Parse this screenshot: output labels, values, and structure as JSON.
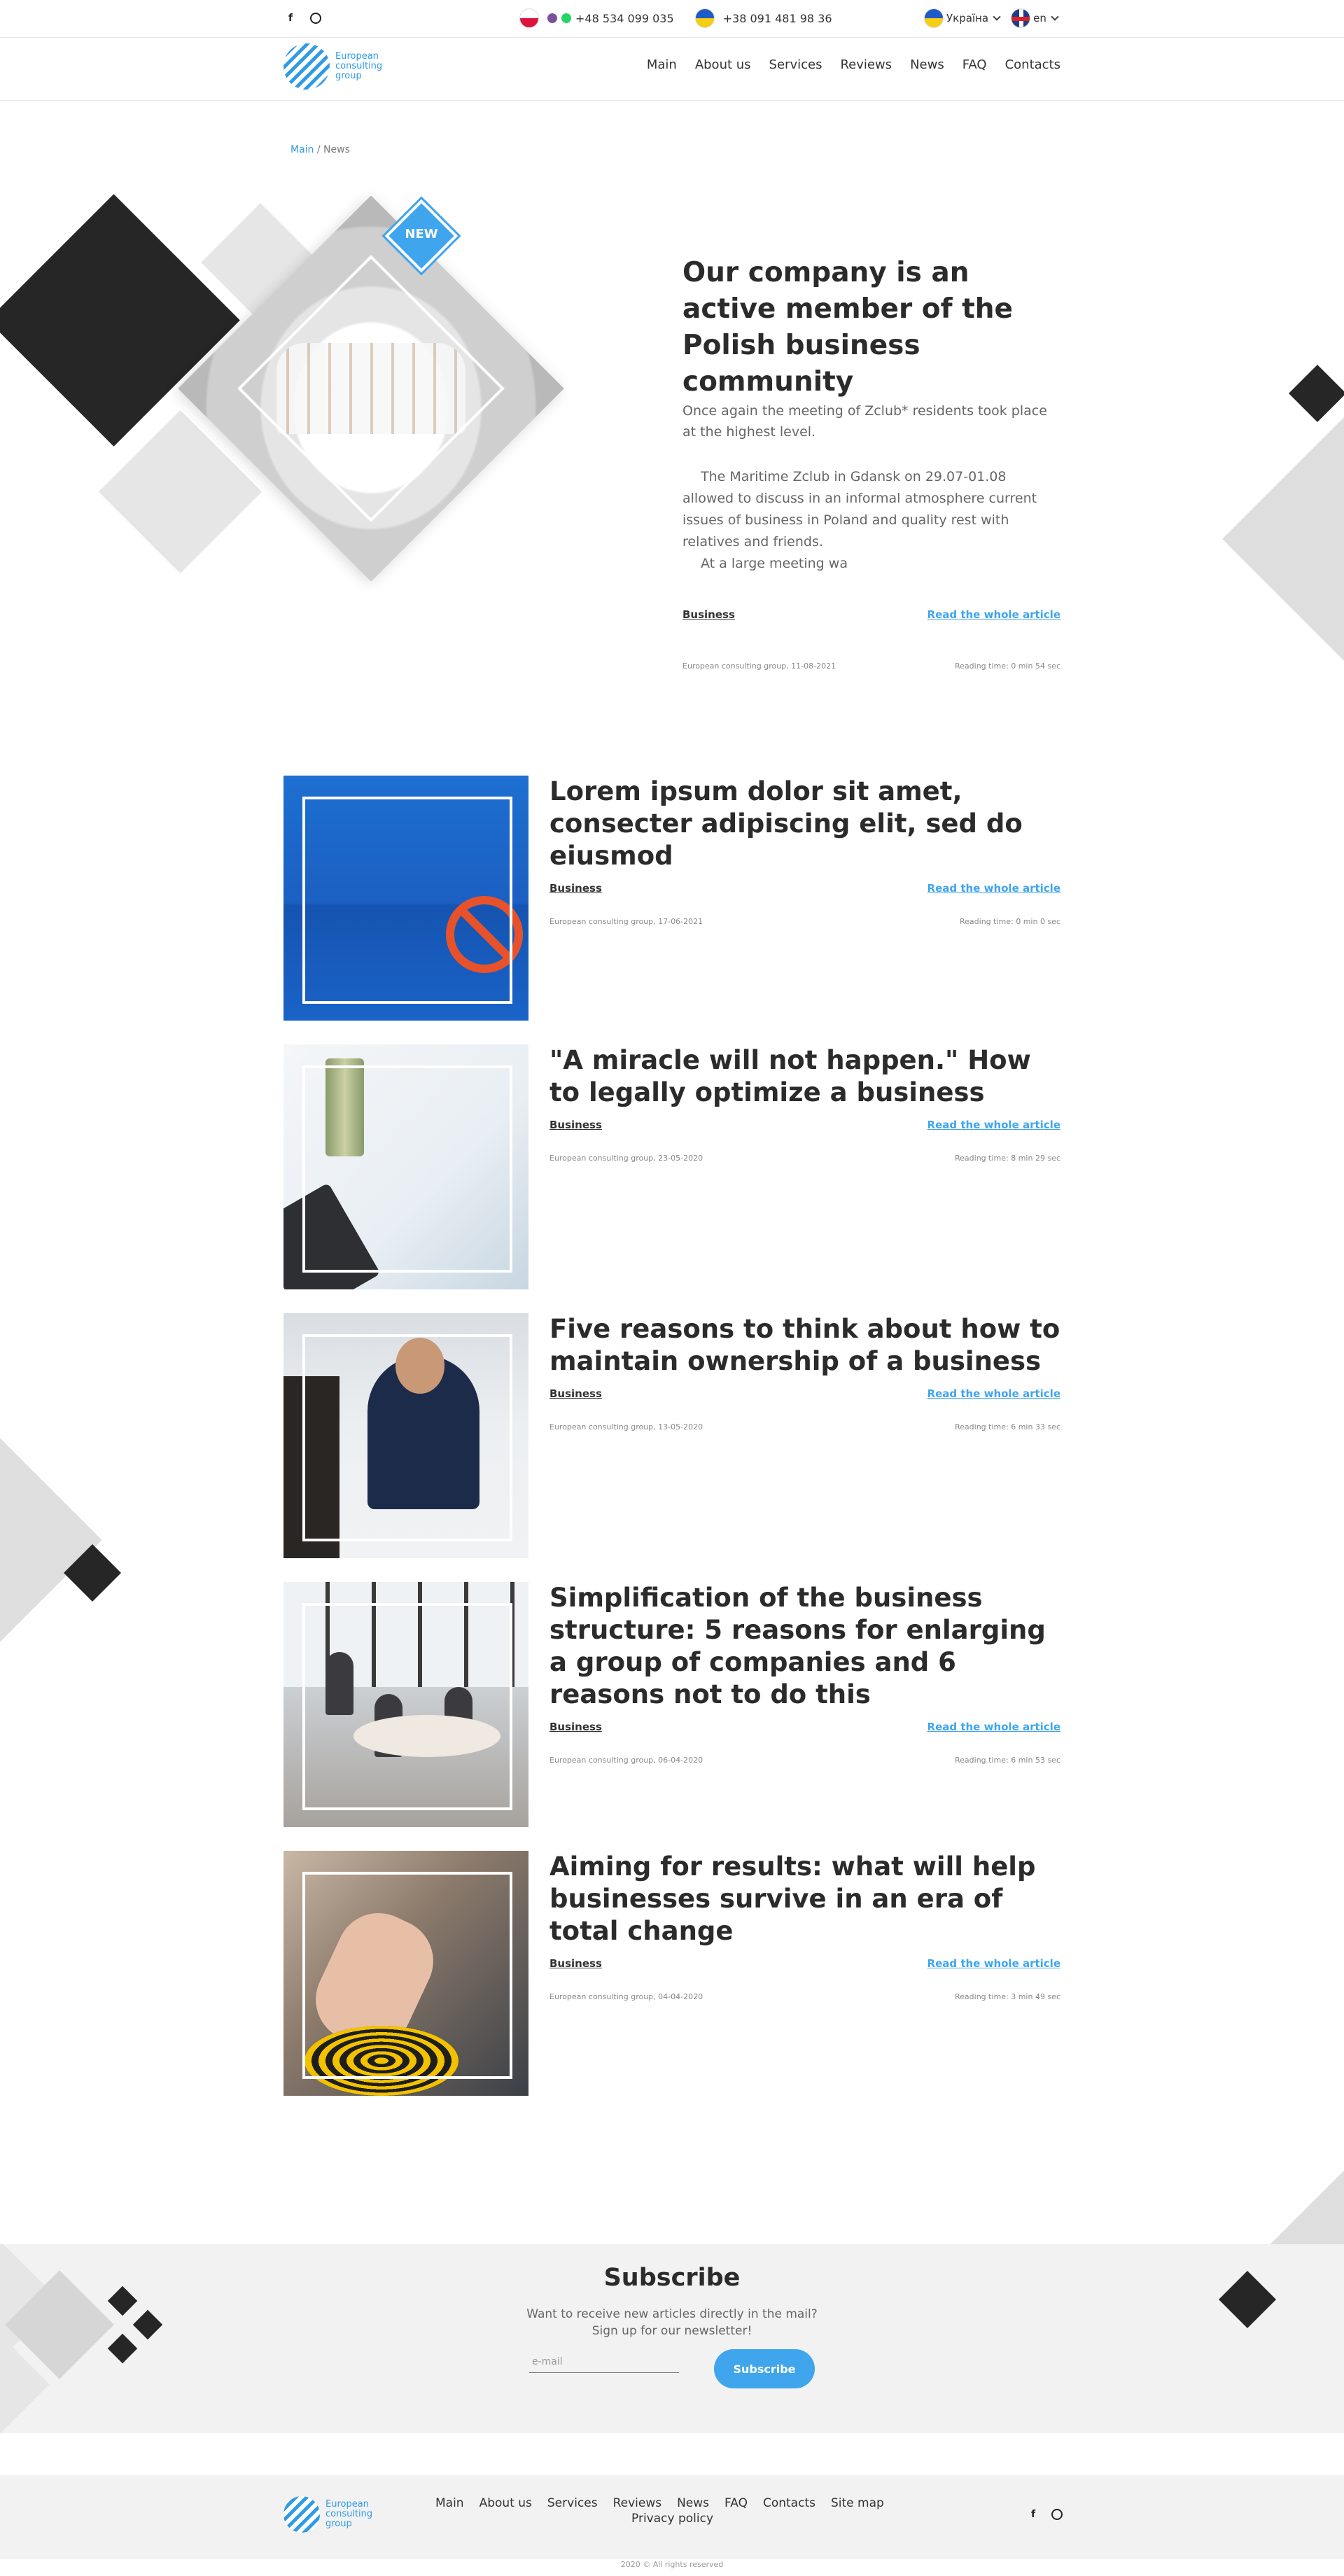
{
  "topbar": {
    "social": [
      "facebook-icon",
      "instagram-icon"
    ],
    "phone1": "+48 534 099 035",
    "phone2": "+38 091 481 98 36",
    "region": "Україна",
    "language": "en"
  },
  "header": {
    "logo_text": "European consulting group",
    "nav": [
      "Main",
      "About us",
      "Services",
      "Reviews",
      "News",
      "FAQ",
      "Contacts"
    ]
  },
  "breadcrumb": {
    "home": "Main",
    "separator": " / ",
    "current": "News"
  },
  "featured": {
    "badge": "NEW",
    "title": "Our company is an active member of the Polish business community",
    "lead": "Once again the meeting of Zclub* residents took place at the highest level.",
    "body": "The Maritime Zclub in Gdansk on 29.07-01.08 allowed to discuss in an informal atmosphere current issues of business in Poland and quality rest with relatives and friends.",
    "body2": "At a large meeting wa",
    "category": "Business",
    "read_more": "Read the whole article",
    "source_date": "European consulting group, 11-08-2021",
    "reading_time": "Reading time: 0 min 54 sec"
  },
  "articles": [
    {
      "title": "Lorem ipsum dolor sit amet, consecter adipiscing elit, sed do eiusmod",
      "category": "Business",
      "read_more": "Read the whole article",
      "source_date": "European consulting group, 17-06-2021",
      "reading_time": "Reading time: 0 min 0 sec"
    },
    {
      "title": "\"A miracle will not happen.\" How to legally optimize a business",
      "category": "Business",
      "read_more": "Read the whole article",
      "source_date": "European consulting group, 23-05-2020",
      "reading_time": "Reading time: 8 min 29 sec"
    },
    {
      "title": "Five reasons to think about how to maintain ownership of a business",
      "category": "Business",
      "read_more": "Read the whole article",
      "source_date": "European consulting group, 13-05-2020",
      "reading_time": "Reading time: 6 min 33 sec"
    },
    {
      "title": "Simplification of the business structure: 5 reasons for enlarging a group of companies and 6 reasons not to do this",
      "category": "Business",
      "read_more": "Read the whole article",
      "source_date": "European consulting group, 06-04-2020",
      "reading_time": "Reading time: 6 min 53 sec"
    },
    {
      "title": "Aiming for results: what will help businesses survive in an era of total change",
      "category": "Business",
      "read_more": "Read the whole article",
      "source_date": "European consulting group, 04-04-2020",
      "reading_time": "Reading time: 3 min 49 sec"
    }
  ],
  "subscribe": {
    "title": "Subscribe",
    "description_line1": "Want to receive new articles directly in the mail?",
    "description_line2": "Sign up for our newsletter!",
    "email_placeholder": "e-mail",
    "button": "Subscribe"
  },
  "footer": {
    "logo_text": "European consulting group",
    "nav": [
      "Main",
      "About us",
      "Services",
      "Reviews",
      "News",
      "FAQ",
      "Contacts",
      "Site map"
    ],
    "privacy": "Privacy policy",
    "copyright": "2020 © All rights reserved"
  },
  "colors": {
    "accent": "#3fa5ec",
    "dark": "#262626",
    "grey_shape": "#dedede"
  }
}
